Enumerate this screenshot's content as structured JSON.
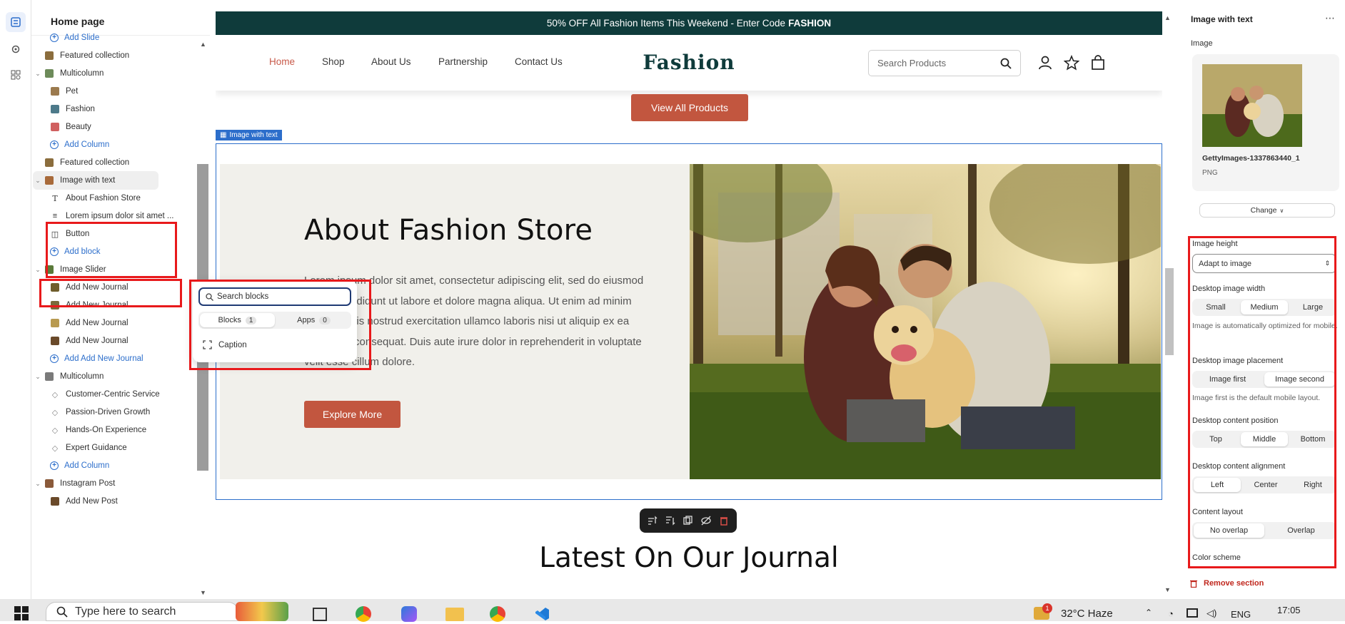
{
  "sidebar": {
    "title": "Home page",
    "items": [
      {
        "label": "Add Slide",
        "kind": "add",
        "indent": 2
      },
      {
        "label": "Featured collection",
        "kind": "section",
        "indent": 1,
        "color": "#8b6d3d"
      },
      {
        "label": "Multicolumn",
        "kind": "section",
        "indent": 1,
        "chevron": true,
        "color": "#6d8b5a"
      },
      {
        "label": "Pet",
        "kind": "block",
        "indent": 2,
        "color": "#9b7a4e"
      },
      {
        "label": "Fashion",
        "kind": "block",
        "indent": 2,
        "color": "#4d7a8a"
      },
      {
        "label": "Beauty",
        "kind": "block",
        "indent": 2,
        "color": "#d06060"
      },
      {
        "label": "Add Column",
        "kind": "add",
        "indent": 2
      },
      {
        "label": "Featured collection",
        "kind": "section",
        "indent": 1,
        "color": "#8b6d3d"
      },
      {
        "label": "Image with text",
        "kind": "section",
        "indent": 1,
        "chevron": true,
        "selected": true,
        "color": "#a86a3a"
      },
      {
        "label": "About Fashion Store",
        "kind": "text-block",
        "indent": 2
      },
      {
        "label": "Lorem ipsum dolor sit amet ...",
        "kind": "paragraph-block",
        "indent": 2
      },
      {
        "label": "Button",
        "kind": "button-block",
        "indent": 2
      },
      {
        "label": "Add block",
        "kind": "add",
        "indent": 2
      },
      {
        "label": "Image Slider",
        "kind": "section",
        "indent": 1,
        "chevron": true,
        "color": "#5a7a3a"
      },
      {
        "label": "Add New Journal",
        "kind": "block",
        "indent": 2,
        "color": "#6f5d2c"
      },
      {
        "label": "Add New Journal",
        "kind": "block",
        "indent": 2,
        "color": "#7a6a3a"
      },
      {
        "label": "Add New Journal",
        "kind": "block",
        "indent": 2,
        "color": "#b89a50"
      },
      {
        "label": "Add New Journal",
        "kind": "block",
        "indent": 2,
        "color": "#6a4a2a"
      },
      {
        "label": "Add Add New Journal",
        "kind": "add",
        "indent": 2
      },
      {
        "label": "Multicolumn",
        "kind": "section",
        "indent": 1,
        "chevron": true,
        "color": "#7a7a7a"
      },
      {
        "label": "Customer-Centric Service",
        "kind": "icon-block",
        "indent": 2
      },
      {
        "label": "Passion-Driven Growth",
        "kind": "icon-block",
        "indent": 2
      },
      {
        "label": "Hands-On Experience",
        "kind": "icon-block",
        "indent": 2
      },
      {
        "label": "Expert Guidance",
        "kind": "icon-block",
        "indent": 2
      },
      {
        "label": "Add Column",
        "kind": "add",
        "indent": 2
      },
      {
        "label": "Instagram Post",
        "kind": "section",
        "indent": 1,
        "chevron": true,
        "color": "#8a5a3a"
      },
      {
        "label": "Add New Post",
        "kind": "block",
        "indent": 2,
        "color": "#6a4a2a"
      }
    ]
  },
  "popup": {
    "search_placeholder": "Search blocks",
    "tabs": [
      {
        "label": "Blocks",
        "count": "1",
        "active": true
      },
      {
        "label": "Apps",
        "count": "0",
        "active": false
      }
    ],
    "items": [
      {
        "label": "Caption",
        "icon": "caption-icon"
      }
    ]
  },
  "preview": {
    "promo_text": "50% OFF All Fashion Items This Weekend - Enter Code",
    "promo_code": "FASHION",
    "nav": [
      "Home",
      "Shop",
      "About Us",
      "Partnership",
      "Contact Us"
    ],
    "logo": "Fashion",
    "search_placeholder": "Search Products",
    "view_all_label": "View All Products",
    "section_tag": "Image with text",
    "heading": "About Fashion Store",
    "body": "Lorem ipsum dolor sit amet, consectetur adipiscing elit, sed do eiusmod tempor incididunt ut labore et dolore magna aliqua. Ut enim ad minim veniam, quis nostrud exercitation ullamco laboris nisi ut aliquip ex ea commodo consequat. Duis aute irure dolor in reprehenderit in voluptate velit esse cillum dolore.",
    "button_label": "Explore More",
    "journal_title": "Latest On Our Journal"
  },
  "settings": {
    "title": "Image with text",
    "image_label": "Image",
    "file_name": "GettyImages-1337863440_1",
    "file_type": "PNG",
    "change_label": "Change",
    "image_height_label": "Image height",
    "image_height_value": "Adapt to image",
    "desktop_width_label": "Desktop image width",
    "desktop_width_options": [
      "Small",
      "Medium",
      "Large"
    ],
    "desktop_width_help": "Image is automatically optimized for mobile.",
    "placement_label": "Desktop image placement",
    "placement_options": [
      "Image first",
      "Image second"
    ],
    "placement_help": "Image first is the default mobile layout.",
    "content_position_label": "Desktop content position",
    "content_position_options": [
      "Top",
      "Middle",
      "Bottom"
    ],
    "content_alignment_label": "Desktop content alignment",
    "content_alignment_options": [
      "Left",
      "Center",
      "Right"
    ],
    "content_layout_label": "Content layout",
    "content_layout_options": [
      "No overlap",
      "Overlap"
    ],
    "color_scheme_label": "Color scheme",
    "remove_label": "Remove section"
  },
  "taskbar": {
    "search_placeholder": "Type here to search",
    "weather": "32°C  Haze",
    "language": "ENG",
    "time": "17:05",
    "notification_count": "1"
  },
  "colors": {
    "accent": "#2c6ecb",
    "brand_dark": "#0f3b3b",
    "button_red": "#c2563f",
    "highlight_red": "#e8191b"
  }
}
